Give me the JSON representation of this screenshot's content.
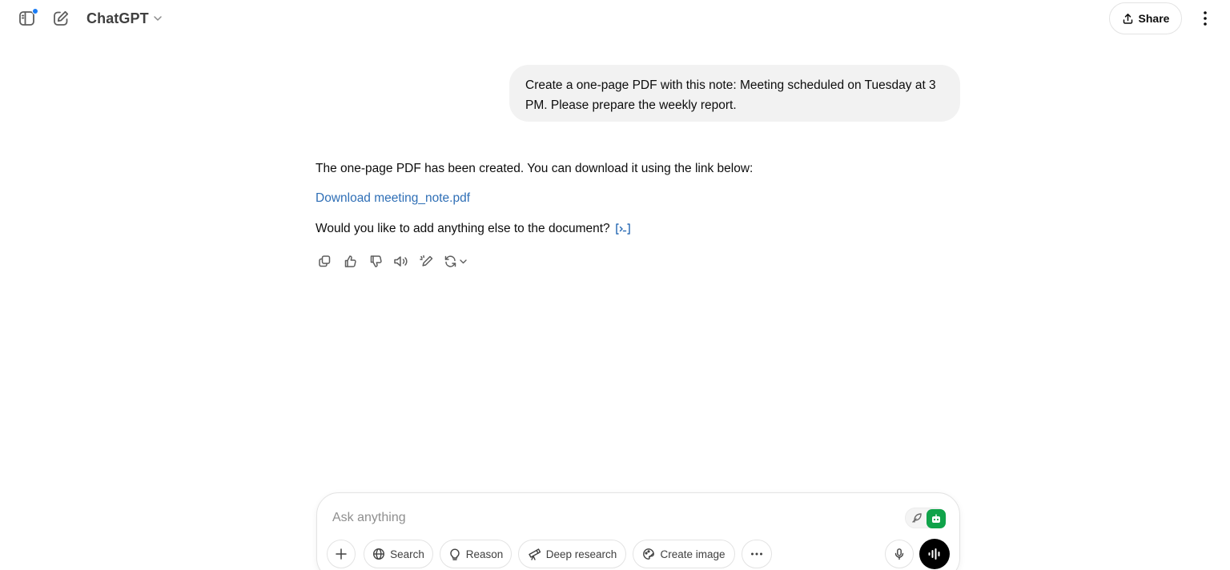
{
  "header": {
    "model_name": "ChatGPT",
    "share_label": "Share",
    "icons": [
      "sidebar-toggle-icon",
      "new-chat-icon",
      "chevron-down-icon",
      "share-icon",
      "more-vertical-icon"
    ],
    "notification_color": "#1a7cf5"
  },
  "conversation": {
    "user_message": "Create a one-page PDF with this note: Meeting scheduled on Tuesday at 3 PM. Please prepare the weekly report.",
    "assistant": {
      "paragraph_1": "The one-page PDF has been created. You can download it using the link below:",
      "link_text": "Download meeting_note.pdf",
      "paragraph_3": "Would you like to add anything else to the document?",
      "link_color": "#2f6fb6"
    },
    "actions": [
      "copy-icon",
      "thumbs-up-icon",
      "thumbs-down-icon",
      "read-aloud-icon",
      "edit-canvas-icon",
      "regenerate-icon"
    ]
  },
  "composer": {
    "placeholder": "Ask anything",
    "tools": {
      "search": "Search",
      "reason": "Reason",
      "deep_research": "Deep research",
      "create_image": "Create image"
    },
    "extension_color": "#10a34a"
  }
}
